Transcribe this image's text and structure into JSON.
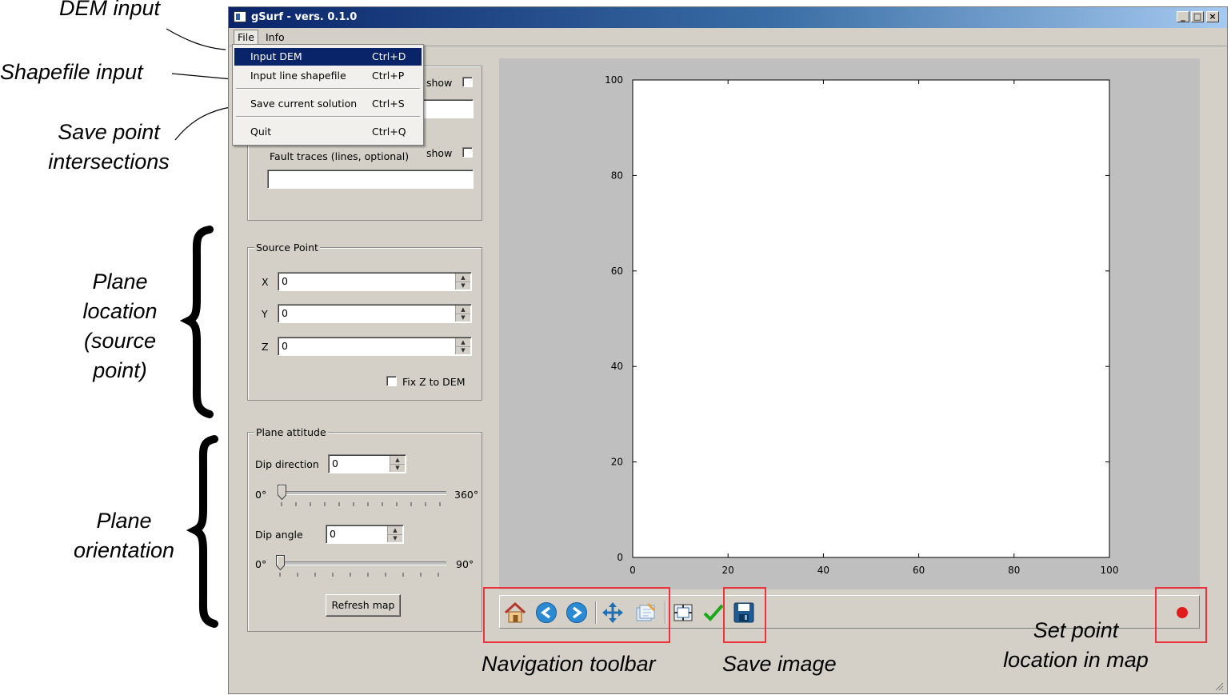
{
  "annotations": {
    "dem_input": "DEM input",
    "shapefile_input": "Shapefile input",
    "save_points_line1": "Save point",
    "save_points_line2": "intersections",
    "plane_location": [
      "Plane",
      "location",
      "(source",
      "point)"
    ],
    "plane_orientation": [
      "Plane",
      "orientation"
    ],
    "navigation_toolbar": "Navigation toolbar",
    "save_image": "Save image",
    "set_point_line1": "Set point",
    "set_point_line2": "location in map"
  },
  "window": {
    "title": "gSurf  - vers. 0.1.0",
    "controls": [
      "_",
      "□",
      "×"
    ]
  },
  "menubar": {
    "file": "File",
    "info": "Info"
  },
  "file_menu": [
    {
      "label": "Input DEM",
      "shortcut": "Ctrl+D"
    },
    {
      "label": "Input line shapefile",
      "shortcut": "Ctrl+P"
    },
    {
      "label": "Save current solution",
      "shortcut": "Ctrl+S"
    },
    {
      "label": "Quit",
      "shortcut": "Ctrl+Q"
    }
  ],
  "input_panel": {
    "show1": "show",
    "show2": "show",
    "dem_path": "",
    "fault_label": "Fault traces (lines, optional)",
    "fault_path": ""
  },
  "source_point": {
    "title": "Source Point",
    "x_label": "X",
    "x_value": "0",
    "y_label": "Y",
    "y_value": "0",
    "z_label": "Z",
    "z_value": "0",
    "fix_z_label": "Fix Z to DEM"
  },
  "plane_attitude": {
    "title": "Plane attitude",
    "dip_direction_label": "Dip direction",
    "dip_direction_value": "0",
    "dir_min": "0°",
    "dir_max": "360°",
    "dip_angle_label": "Dip angle",
    "dip_angle_value": "0",
    "angle_min": "0°",
    "angle_max": "90°",
    "refresh_label": "Refresh map"
  },
  "chart_data": {
    "type": "scatter",
    "xlim": [
      0,
      100
    ],
    "ylim": [
      0,
      100
    ],
    "x_ticks": [
      "0",
      "20",
      "40",
      "60",
      "80",
      "100"
    ],
    "y_ticks": [
      "0",
      "20",
      "40",
      "60",
      "80",
      "100"
    ],
    "series": []
  },
  "toolbar_icons": [
    "home-icon",
    "back-arrow-icon",
    "forward-arrow-icon",
    "pan-icon",
    "zoom-icon",
    "configure-subplots-icon",
    "check-icon",
    "save-disk-icon",
    "red-point-icon"
  ],
  "colors": {
    "annotation_box": "#e8343a",
    "point_marker": "#e01b1b",
    "menu_highlight": "#0a246a"
  }
}
